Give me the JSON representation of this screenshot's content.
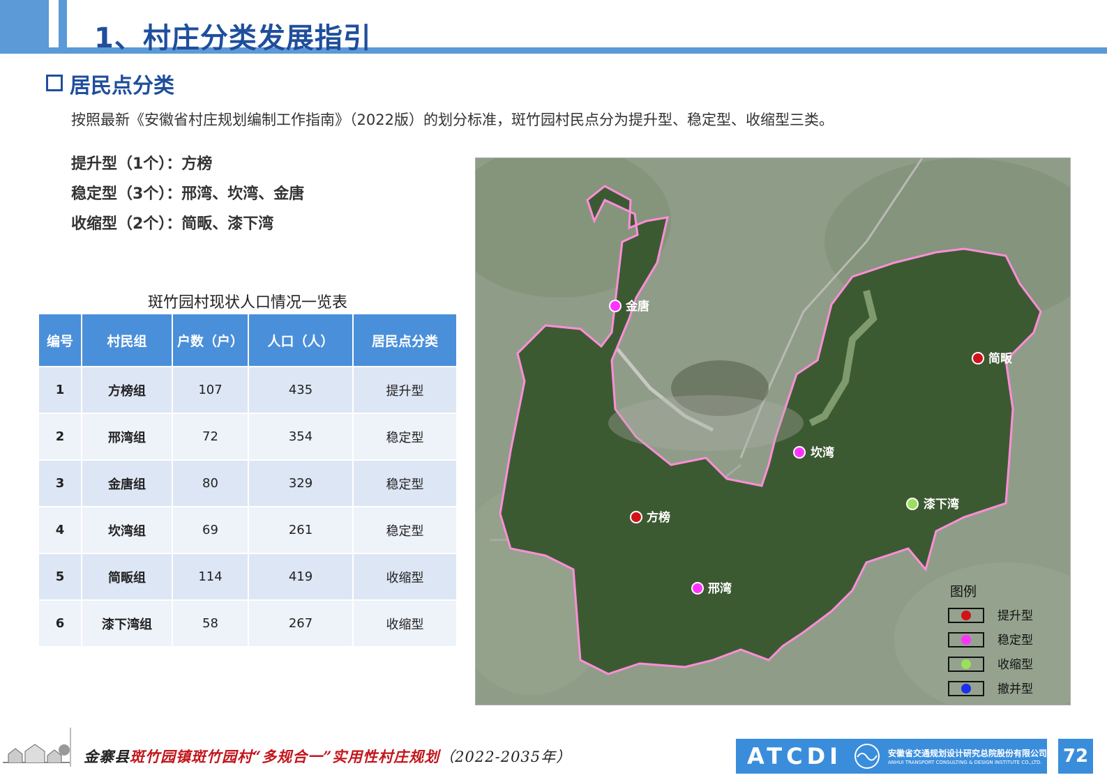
{
  "header": {
    "title": "1、村庄分类发展指引"
  },
  "section": {
    "title": "居民点分类"
  },
  "intro": "按照最新《安徽省村庄规划编制工作指南》（2022版）的划分标准，斑竹园村民点分为提升型、稳定型、收缩型三类。",
  "categories": [
    "提升型（1个）：方榜",
    "稳定型（3个）：邢湾、坎湾、金唐",
    "收缩型（2个）：简畈、漆下湾"
  ],
  "table": {
    "title": "斑竹园村现状人口情况一览表",
    "headers": [
      "编号",
      "村民组",
      "户数（户）",
      "人口（人）",
      "居民点分类"
    ],
    "rows": [
      [
        "1",
        "方榜组",
        "107",
        "435",
        "提升型"
      ],
      [
        "2",
        "邢湾组",
        "72",
        "354",
        "稳定型"
      ],
      [
        "3",
        "金唐组",
        "80",
        "329",
        "稳定型"
      ],
      [
        "4",
        "坎湾组",
        "69",
        "261",
        "稳定型"
      ],
      [
        "5",
        "简畈组",
        "114",
        "419",
        "收缩型"
      ],
      [
        "6",
        "漆下湾组",
        "58",
        "267",
        "收缩型"
      ]
    ]
  },
  "map": {
    "points": [
      {
        "label": "金唐",
        "type": "稳定型"
      },
      {
        "label": "简畈",
        "type": "提升型"
      },
      {
        "label": "坎湾",
        "type": "稳定型"
      },
      {
        "label": "漆下湾",
        "type": "收缩型"
      },
      {
        "label": "方榜",
        "type": "提升型"
      },
      {
        "label": "邢湾",
        "type": "稳定型"
      }
    ],
    "legend": {
      "title": "图例",
      "items": [
        {
          "label": "提升型",
          "color": "#d0121b"
        },
        {
          "label": "稳定型",
          "color": "#ff33ff"
        },
        {
          "label": "收缩型",
          "color": "#9be05a"
        },
        {
          "label": "撤并型",
          "color": "#1a2ff0"
        }
      ]
    },
    "boundary_color": "#ff8ed8"
  },
  "footer": {
    "prefix": "金寨县",
    "highlight": "斑竹园镇斑竹园村",
    "suffix": "“多规合一”实用性村庄规划",
    "years": "（2022-2035年）",
    "logo_text": "ATCDI",
    "org_cn": "安徽省交通规划设计研究总院股份有限公司",
    "org_en": "ANHUI TRANSPORT CONSULTING & DESIGN INSTITUTE CO.,LTD.",
    "page_number": "72"
  }
}
